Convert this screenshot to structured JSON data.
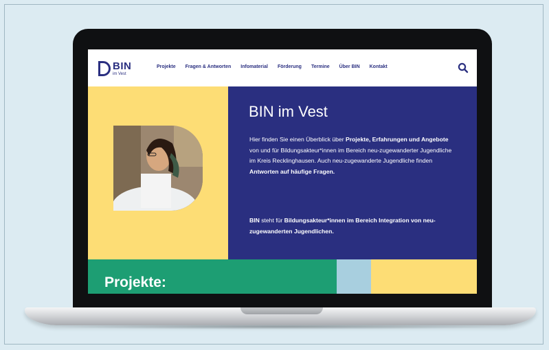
{
  "logo": {
    "main": "BIN",
    "sub": "im Vest"
  },
  "nav": {
    "items": [
      "Projekte",
      "Fragen & Antworten",
      "Infomaterial",
      "Förderung",
      "Termine",
      "Über BIN",
      "Kontakt"
    ]
  },
  "hero": {
    "title": "BIN im Vest",
    "p1": [
      {
        "t": "Hier finden Sie einen Überblick über ",
        "b": false
      },
      {
        "t": "Projekte, Erfahrungen und Angebote",
        "b": true
      },
      {
        "t": " von und für Bildungsakteur*innen im Bereich neu-zugewanderter Jugendliche im Kreis Recklinghausen. Auch neu-zugewanderte Jugendliche finden ",
        "b": false
      },
      {
        "t": "Antworten auf häufige Fragen.",
        "b": true
      }
    ],
    "p2": [
      {
        "t": "BIN",
        "b": true
      },
      {
        "t": " steht für ",
        "b": false
      },
      {
        "t": "Bildungsakteur*innen im Bereich Integration von neu-zugewanderten Jugendlichen.",
        "b": true
      }
    ]
  },
  "section": {
    "title": "Projekte:"
  },
  "icons": {
    "search": "search-icon"
  },
  "colors": {
    "navy": "#2a2f80",
    "yellow": "#fddd75",
    "green": "#1d9e73",
    "lightblue": "#a8cfdf",
    "background": "#dcebf2"
  }
}
